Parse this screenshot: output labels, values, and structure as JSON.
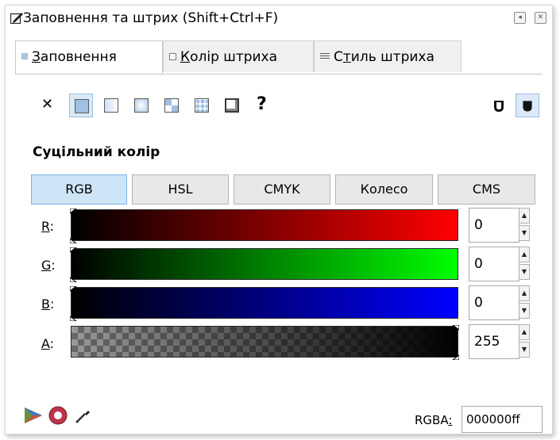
{
  "window": {
    "title": "Заповнення та штрих (Shift+Ctrl+F)"
  },
  "tabs": [
    {
      "label_pre": "",
      "accel": "З",
      "label_post": "аповнення",
      "active": true
    },
    {
      "label_pre": "",
      "accel": "К",
      "label_post": "олір штриха",
      "active": false
    },
    {
      "label_pre": "С",
      "accel": "т",
      "label_post": "иль штриха",
      "active": false
    }
  ],
  "fill_types": {
    "none_glyph": "✕",
    "unset_glyph": "?",
    "selected": "flat-color"
  },
  "section": {
    "title": "Суцільний колір"
  },
  "color_modes": [
    "RGB",
    "HSL",
    "CMYK",
    "Колесо",
    "CMS"
  ],
  "active_mode": "RGB",
  "channels": [
    {
      "accel": "R",
      "suffix": ":",
      "value": "0",
      "gradient_end": "#ff0000"
    },
    {
      "accel": "G",
      "suffix": ":",
      "value": "0",
      "gradient_end": "#00ff00"
    },
    {
      "accel": "B",
      "suffix": ":",
      "value": "0",
      "gradient_end": "#0000ff"
    },
    {
      "accel": "A",
      "suffix": ":",
      "value": "255",
      "gradient_end": "#000000"
    }
  ],
  "rgba": {
    "label": "RGBA",
    "accel_suffix": ":",
    "value": "000000ff"
  },
  "colors": {
    "accent_selected": "#dbe9f8",
    "swatch_fill": "#9fbfe3"
  }
}
